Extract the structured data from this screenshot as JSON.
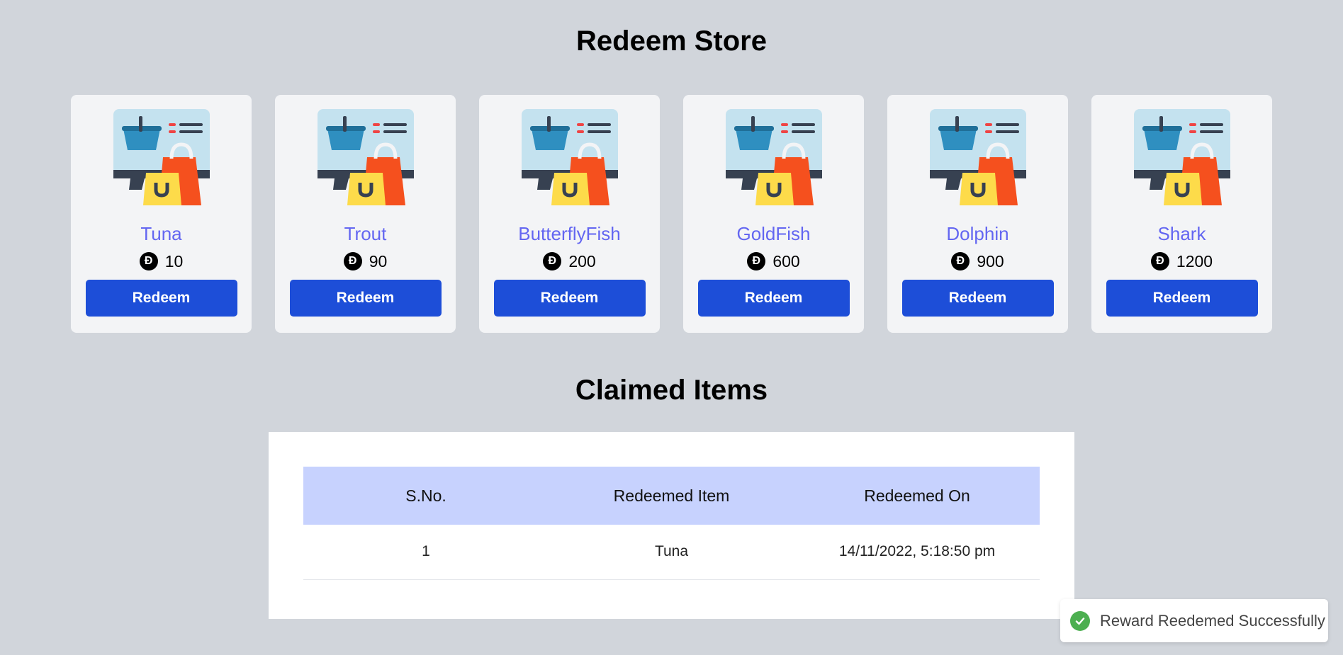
{
  "page": {
    "title": "Redeem Store"
  },
  "store": {
    "items": [
      {
        "name": "Tuna",
        "price": "10",
        "button": "Redeem",
        "image_icon": "shopping-store-icon"
      },
      {
        "name": "Trout",
        "price": "90",
        "button": "Redeem",
        "image_icon": "shopping-store-icon"
      },
      {
        "name": "ButterflyFish",
        "price": "200",
        "button": "Redeem",
        "image_icon": "shopping-store-icon"
      },
      {
        "name": "GoldFish",
        "price": "600",
        "button": "Redeem",
        "image_icon": "shopping-store-icon"
      },
      {
        "name": "Dolphin",
        "price": "900",
        "button": "Redeem",
        "image_icon": "shopping-store-icon"
      },
      {
        "name": "Shark",
        "price": "1200",
        "button": "Redeem",
        "image_icon": "shopping-store-icon"
      }
    ],
    "coin_symbol": "Đ"
  },
  "claimed": {
    "title": "Claimed Items",
    "columns": [
      "S.No.",
      "Redeemed Item",
      "Redeemed On"
    ],
    "rows": [
      [
        "1",
        "Tuna",
        "14/11/2022, 5:18:50 pm"
      ]
    ]
  },
  "toast": {
    "text": "Reward Reedemed Successfully",
    "icon": "check-circle-icon"
  },
  "colors": {
    "background": "#d1d5db",
    "card": "#f3f4f6",
    "item_name": "#6366f1",
    "button": "#1d4ed8",
    "table_header": "#c7d2fe",
    "success": "#4caf50"
  }
}
